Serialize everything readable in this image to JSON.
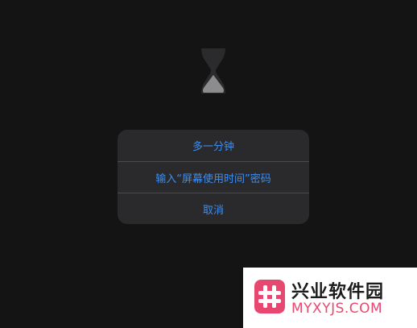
{
  "screen": {
    "icon": "hourglass-icon"
  },
  "alert": {
    "buttons": [
      {
        "label": "多一分钟"
      },
      {
        "label": "输入“屏幕使用时间”密码"
      },
      {
        "label": "取消"
      }
    ],
    "accent_color": "#3d8ef0"
  },
  "watermark": {
    "logo_icon": "hash-logo-icon",
    "site_name": "兴业软件园",
    "site_url": "MYXYJS.COM",
    "brand_color": "#e8486f"
  }
}
